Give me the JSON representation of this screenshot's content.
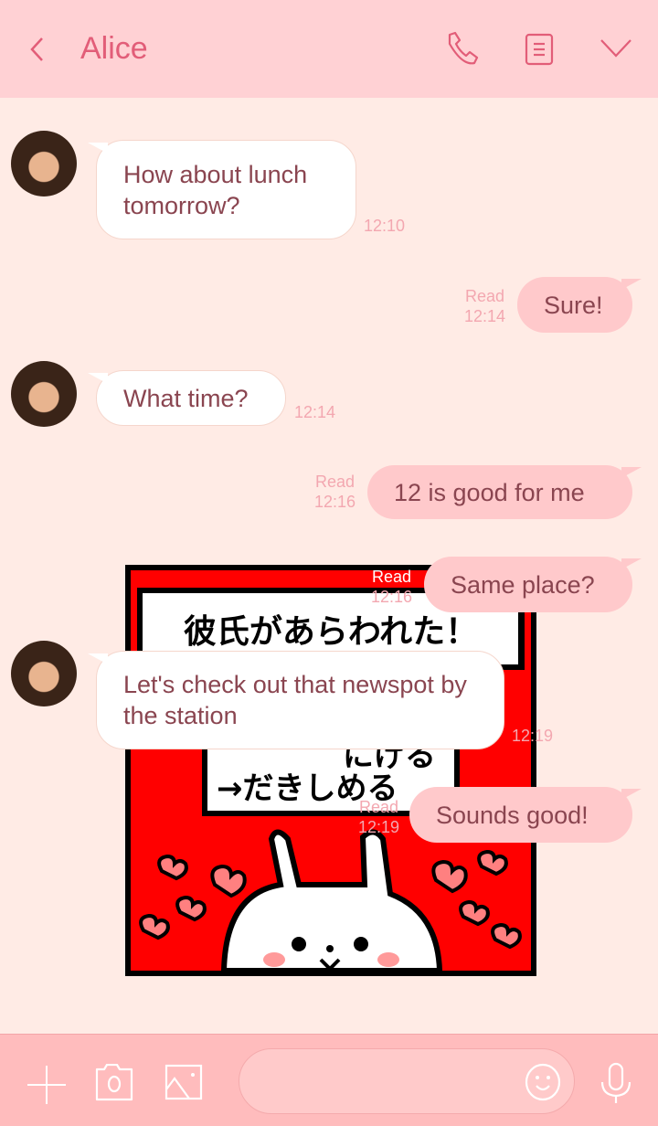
{
  "header": {
    "title": "Alice",
    "back_icon": "chevron-left-icon",
    "call_icon": "phone-icon",
    "notes_icon": "notes-icon",
    "menu_icon": "chevron-down-icon"
  },
  "colors": {
    "header_bg": "#ffd1d4",
    "chat_bg": "#ffebe5",
    "bottom_bg": "#ffbcbd",
    "accent": "#e25d78",
    "outgoing_bubble": "#ffc9cb",
    "incoming_bubble": "#ffffff",
    "text": "#8a4550"
  },
  "messages": [
    {
      "direction": "incoming",
      "text": "How about lunch tomorrow?",
      "time": "12:10"
    },
    {
      "direction": "outgoing",
      "text": "Sure!",
      "read": "Read",
      "time": "12:14"
    },
    {
      "direction": "incoming",
      "text": "What time?",
      "time": "12:14"
    },
    {
      "direction": "outgoing",
      "text": "12 is good for me",
      "read": "Read",
      "time": "12:16"
    },
    {
      "direction": "incoming",
      "type": "sticker",
      "sticker_text": [
        "彼氏があらわれた！",
        "にげる",
        "→だきしめる"
      ]
    },
    {
      "direction": "outgoing",
      "text": "Same place?",
      "read": "Read",
      "time": "12:16"
    },
    {
      "direction": "incoming",
      "text": "Let's check out that newspot by the station",
      "time": "12:19"
    },
    {
      "direction": "outgoing",
      "text": "Sounds good!",
      "read": "Read",
      "time": "12:19"
    }
  ],
  "bottom": {
    "input_value": "",
    "icons": [
      "plus-icon",
      "camera-icon",
      "image-icon",
      "emoji-icon",
      "microphone-icon"
    ]
  }
}
